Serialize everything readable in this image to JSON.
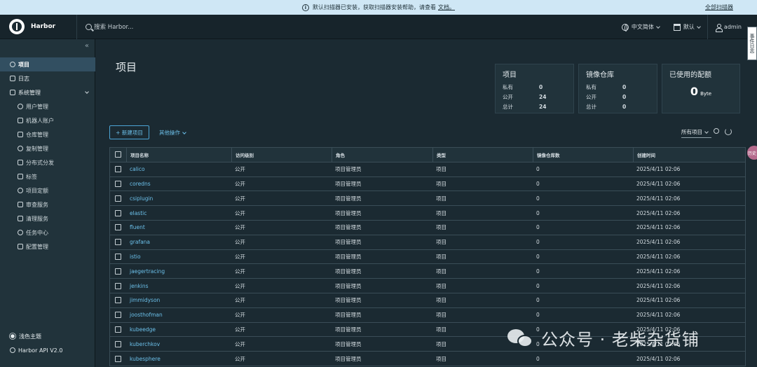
{
  "banner": {
    "message": "默认扫描器已安装，获取扫描器安装帮助，请查看",
    "link": "文档。",
    "dismiss": "全部扫描器"
  },
  "header": {
    "app_title": "Harbor",
    "search_placeholder": "搜索 Harbor...",
    "language": "中文简体",
    "date_format": "默认",
    "user": "admin",
    "side_tab": "事件日志"
  },
  "sidebar": {
    "collapse_symbol": "«",
    "items": [
      {
        "label": "项目",
        "icon": "projects-icon",
        "active": true,
        "sub": false
      },
      {
        "label": "日志",
        "icon": "logs-icon",
        "active": false,
        "sub": false
      },
      {
        "label": "系统管理",
        "icon": "admin-icon",
        "active": false,
        "sub": false,
        "expandable": true
      },
      {
        "label": "用户管理",
        "icon": "users-icon",
        "active": false,
        "sub": true
      },
      {
        "label": "机器人账户",
        "icon": "robot-icon",
        "active": false,
        "sub": true
      },
      {
        "label": "仓库管理",
        "icon": "registry-icon",
        "active": false,
        "sub": true
      },
      {
        "label": "复制管理",
        "icon": "replication-icon",
        "active": false,
        "sub": true
      },
      {
        "label": "分布式分发",
        "icon": "distribution-icon",
        "active": false,
        "sub": true
      },
      {
        "label": "标签",
        "icon": "tag-icon",
        "active": false,
        "sub": true
      },
      {
        "label": "项目定额",
        "icon": "quota-icon",
        "active": false,
        "sub": true
      },
      {
        "label": "审查服务",
        "icon": "shield-icon",
        "active": false,
        "sub": true
      },
      {
        "label": "清理服务",
        "icon": "trash-icon",
        "active": false,
        "sub": true
      },
      {
        "label": "任务中心",
        "icon": "task-icon",
        "active": false,
        "sub": true
      },
      {
        "label": "配置管理",
        "icon": "gear-icon",
        "active": false,
        "sub": true
      }
    ],
    "theme": "浅色主题",
    "api": "Harbor API V2.0"
  },
  "main": {
    "title": "项目",
    "cards": {
      "projects": {
        "title": "项目",
        "rows": [
          {
            "k": "私有",
            "v": "0"
          },
          {
            "k": "公开",
            "v": "24"
          },
          {
            "k": "总计",
            "v": "24"
          }
        ]
      },
      "repos": {
        "title": "镜像仓库",
        "rows": [
          {
            "k": "私有",
            "v": "0"
          },
          {
            "k": "公开",
            "v": "0"
          },
          {
            "k": "总计",
            "v": "0"
          }
        ]
      },
      "quota": {
        "title": "已使用的配额",
        "value": "0",
        "unit": "Byte"
      }
    },
    "new_project": "+ 新建项目",
    "other_ops": "其他操作",
    "filter": "所有项目",
    "float_button": "历史",
    "table": {
      "headers": [
        "项目名称",
        "访问级别",
        "角色",
        "类型",
        "镜像仓库数",
        "创建时间"
      ],
      "rows": [
        [
          "calico",
          "公开",
          "项目管理员",
          "项目",
          "0",
          "2025/4/11 02:06"
        ],
        [
          "coredns",
          "公开",
          "项目管理员",
          "项目",
          "0",
          "2025/4/11 02:06"
        ],
        [
          "csiplugin",
          "公开",
          "项目管理员",
          "项目",
          "0",
          "2025/4/11 02:06"
        ],
        [
          "elastic",
          "公开",
          "项目管理员",
          "项目",
          "0",
          "2025/4/11 02:06"
        ],
        [
          "fluent",
          "公开",
          "项目管理员",
          "项目",
          "0",
          "2025/4/11 02:06"
        ],
        [
          "grafana",
          "公开",
          "项目管理员",
          "项目",
          "0",
          "2025/4/11 02:06"
        ],
        [
          "istio",
          "公开",
          "项目管理员",
          "项目",
          "0",
          "2025/4/11 02:06"
        ],
        [
          "jaegertracing",
          "公开",
          "项目管理员",
          "项目",
          "0",
          "2025/4/11 02:06"
        ],
        [
          "jenkins",
          "公开",
          "项目管理员",
          "项目",
          "0",
          "2025/4/11 02:06"
        ],
        [
          "jimmidyson",
          "公开",
          "项目管理员",
          "项目",
          "0",
          "2025/4/11 02:06"
        ],
        [
          "joosthofman",
          "公开",
          "项目管理员",
          "项目",
          "0",
          "2025/4/11 02:06"
        ],
        [
          "kubeedge",
          "公开",
          "项目管理员",
          "项目",
          "0",
          "2025/4/11 02:06"
        ],
        [
          "kuberchkov",
          "公开",
          "项目管理员",
          "项目",
          "0",
          "2025/4/11 02:06"
        ],
        [
          "kubesphere",
          "公开",
          "项目管理员",
          "项目",
          "0",
          "2025/4/11 02:06"
        ]
      ]
    }
  },
  "watermark": "公众号 · 老柴杂货铺"
}
